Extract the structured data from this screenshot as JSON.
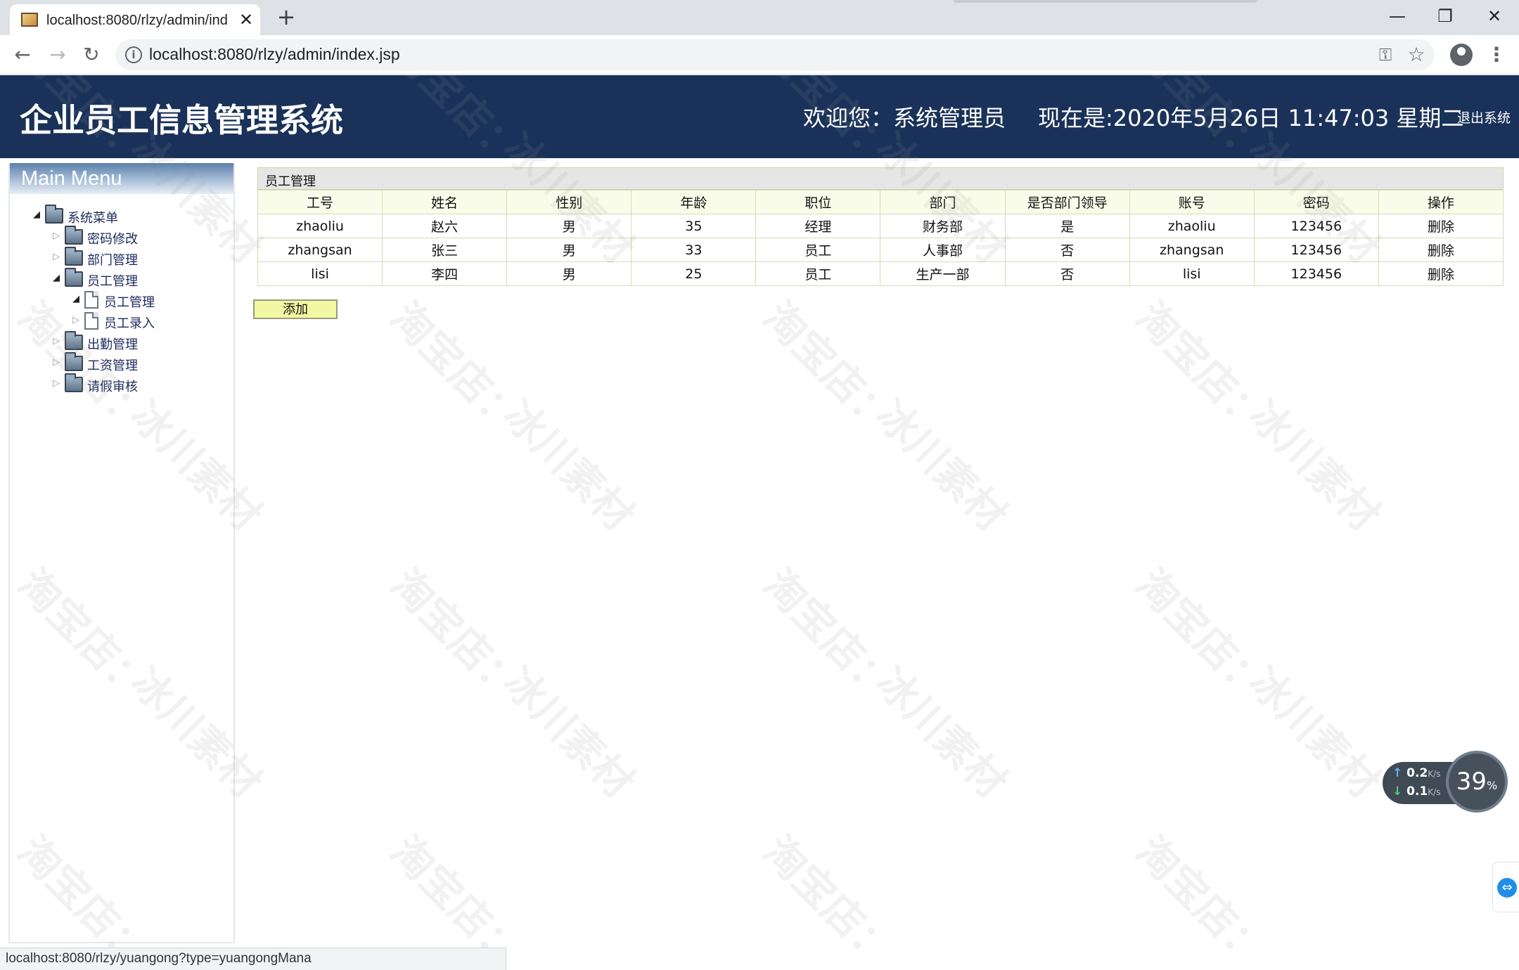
{
  "browser": {
    "tab_title": "localhost:8080/rlzy/admin/ind",
    "tab_close": "✕",
    "new_tab": "+",
    "url": "localhost:8080/rlzy/admin/index.jsp",
    "window_minimize": "—",
    "window_restore": "❐",
    "window_close": "✕",
    "back": "←",
    "forward": "→",
    "reload": "↻",
    "info": "i",
    "key": "⚿",
    "star": "☆",
    "menu": "⋮"
  },
  "header": {
    "system_title": "企业员工信息管理系统",
    "welcome": "欢迎您：系统管理员",
    "datetime": "现在是:2020年5月26日 11:47:03 星期二",
    "logout": "退出系统",
    "background_color": "#1a3259"
  },
  "sidebar": {
    "title": "Main Menu",
    "root_label": "系统菜单",
    "items": [
      {
        "label": "密码修改",
        "expanded": false
      },
      {
        "label": "部门管理",
        "expanded": false
      },
      {
        "label": "员工管理",
        "expanded": true,
        "children": [
          {
            "label": "员工管理"
          },
          {
            "label": "员工录入"
          }
        ]
      },
      {
        "label": "出勤管理",
        "expanded": false
      },
      {
        "label": "工资管理",
        "expanded": false
      },
      {
        "label": "请假审核",
        "expanded": false
      }
    ]
  },
  "main": {
    "panel_title": "员工管理",
    "columns": [
      "工号",
      "姓名",
      "性别",
      "年龄",
      "职位",
      "部门",
      "是否部门领导",
      "账号",
      "密码",
      "操作"
    ],
    "rows": [
      [
        "zhaoliu",
        "赵六",
        "男",
        "35",
        "经理",
        "财务部",
        "是",
        "zhaoliu",
        "123456",
        "删除"
      ],
      [
        "zhangsan",
        "张三",
        "男",
        "33",
        "员工",
        "人事部",
        "否",
        "zhangsan",
        "123456",
        "删除"
      ],
      [
        "lisi",
        "李四",
        "男",
        "25",
        "员工",
        "生产一部",
        "否",
        "lisi",
        "123456",
        "删除"
      ]
    ],
    "add_button": "添加"
  },
  "watermark": {
    "line1": "淘宝店：",
    "line2": "冰川素材"
  },
  "net_widget": {
    "upload": "0.2",
    "download": "0.1",
    "unit": "K/s",
    "up_arrow": "↑",
    "down_arrow": "↓",
    "cpu_percent": "39",
    "percent_sign": "%"
  },
  "status_bar": {
    "text": "localhost:8080/rlzy/yuangong?type=yuangongMana"
  }
}
